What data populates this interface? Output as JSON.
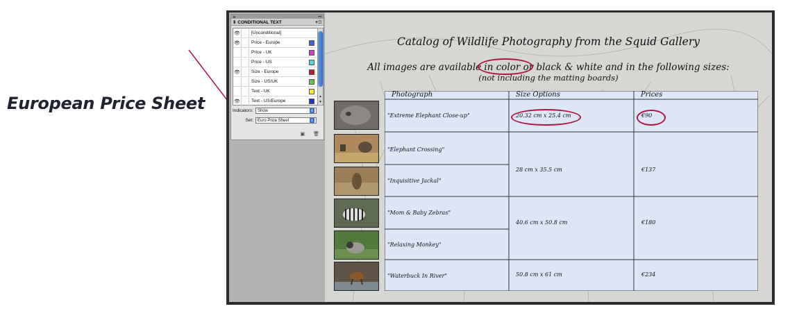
{
  "caption": "European Price Sheet",
  "panel": {
    "title": "CONDITIONAL TEXT",
    "conditions": [
      {
        "name": "[Unconditional]",
        "visible": true,
        "color": ""
      },
      {
        "name": "Price - Europe",
        "visible": true,
        "color": "#3b63d6"
      },
      {
        "name": "Price - UK",
        "visible": false,
        "color": "#d43fc7"
      },
      {
        "name": "Price - US",
        "visible": false,
        "color": "#55d0d6"
      },
      {
        "name": "Size - Europe",
        "visible": true,
        "color": "#c21a2a"
      },
      {
        "name": "Size - US/UK",
        "visible": false,
        "color": "#5ec443"
      },
      {
        "name": "Text - UK",
        "visible": false,
        "color": "#f2e833"
      },
      {
        "name": "Text - US/Europe",
        "visible": true,
        "color": "#2638b8"
      }
    ],
    "indicators_label": "Indicators:",
    "indicators_value": "Show",
    "set_label": "Set:",
    "set_value": "Euro Price Sheet"
  },
  "document": {
    "title": "Catalog of Wildlife Photography from the Squid Gallery",
    "subtitle_line1": "All images are available in color or black & white and in the following sizes:",
    "subtitle_line2": "(not including the matting boards)",
    "table": {
      "headers": [
        "Photograph",
        "Size Options",
        "Prices"
      ],
      "photos": [
        "\"Extreme Elephant Close-up\"",
        "\"Elephant Crossing\"",
        "\"Inquisitive Jackal\"",
        "\"Mom & Baby Zebras\"",
        "\"Relaxing Monkey\"",
        "\"Waterbuck In River\""
      ],
      "sizes": [
        "20.32 cm x 25.4 cm",
        "28 cm x 35.5 cm",
        "40.6 cm x 50.8 cm",
        "50.8 cm x 61 cm"
      ],
      "prices": [
        "€90",
        "€137",
        "€180",
        "€234"
      ]
    }
  },
  "colors": {
    "table_fill": "#dde6f7",
    "annotation": "#b3123f",
    "caption": "#1f2330"
  }
}
